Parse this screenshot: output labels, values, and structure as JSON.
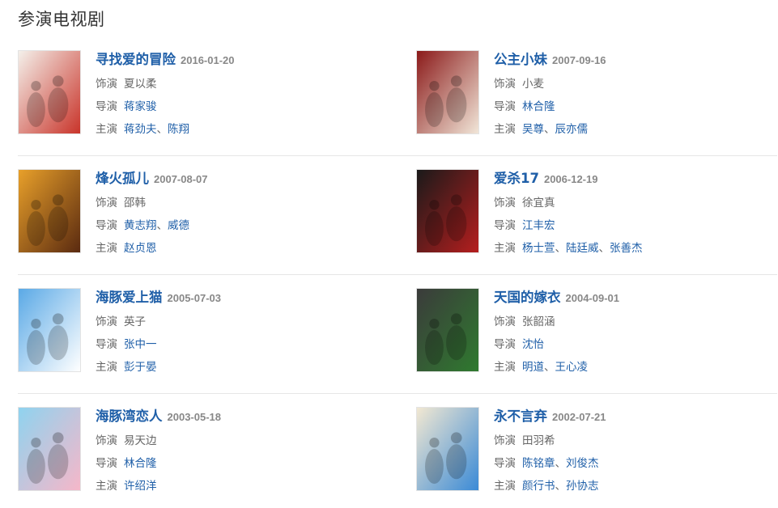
{
  "section": {
    "title": "参演电视剧"
  },
  "labels": {
    "role": "饰演",
    "director": "导演",
    "cast": "主演",
    "sep": "、"
  },
  "shows": [
    {
      "title": "寻找爱的冒险",
      "date": "2016-01-20",
      "role": "夏以柔",
      "directors": [
        "蒋家骏"
      ],
      "cast": [
        "蒋劲夫",
        "陈翔"
      ],
      "poster_colors": [
        "#f4f0ea",
        "#c9342a"
      ]
    },
    {
      "title": "公主小妹",
      "date": "2007-09-16",
      "role": "小麦",
      "directors": [
        "林合隆"
      ],
      "cast": [
        "吴尊",
        "辰亦儒"
      ],
      "poster_colors": [
        "#8b1a1a",
        "#f1e6d8"
      ]
    },
    {
      "title": "烽火孤儿",
      "date": "2007-08-07",
      "role": "邵韩",
      "directors": [
        "黄志翔",
        "威德"
      ],
      "cast": [
        "赵贞恩"
      ],
      "poster_colors": [
        "#e8a02a",
        "#5a2a10"
      ]
    },
    {
      "title": "爱杀17",
      "date": "2006-12-19",
      "role": "徐宜真",
      "directors": [
        "江丰宏"
      ],
      "cast": [
        "杨士萱",
        "陆廷威",
        "张善杰"
      ],
      "poster_colors": [
        "#1a1a1a",
        "#b51e1e"
      ]
    },
    {
      "title": "海豚爱上猫",
      "date": "2005-07-03",
      "role": "英子",
      "directors": [
        "张中一"
      ],
      "cast": [
        "彭于晏"
      ],
      "poster_colors": [
        "#5aa9e6",
        "#ffffff"
      ]
    },
    {
      "title": "天国的嫁衣",
      "date": "2004-09-01",
      "role": "张韶涵",
      "directors": [
        "沈怡"
      ],
      "cast": [
        "明道",
        "王心凌"
      ],
      "poster_colors": [
        "#3b3b3b",
        "#2f7a2f"
      ]
    },
    {
      "title": "海豚湾恋人",
      "date": "2003-05-18",
      "role": "易天边",
      "directors": [
        "林合隆"
      ],
      "cast": [
        "许绍洋"
      ],
      "poster_colors": [
        "#8fd3ef",
        "#f6b7c9"
      ]
    },
    {
      "title": "永不言弃",
      "date": "2002-07-21",
      "role": "田羽希",
      "directors": [
        "陈铭章",
        "刘俊杰"
      ],
      "cast": [
        "颜行书",
        "孙协志"
      ],
      "poster_colors": [
        "#f2e8d2",
        "#3a8ad6"
      ]
    }
  ]
}
